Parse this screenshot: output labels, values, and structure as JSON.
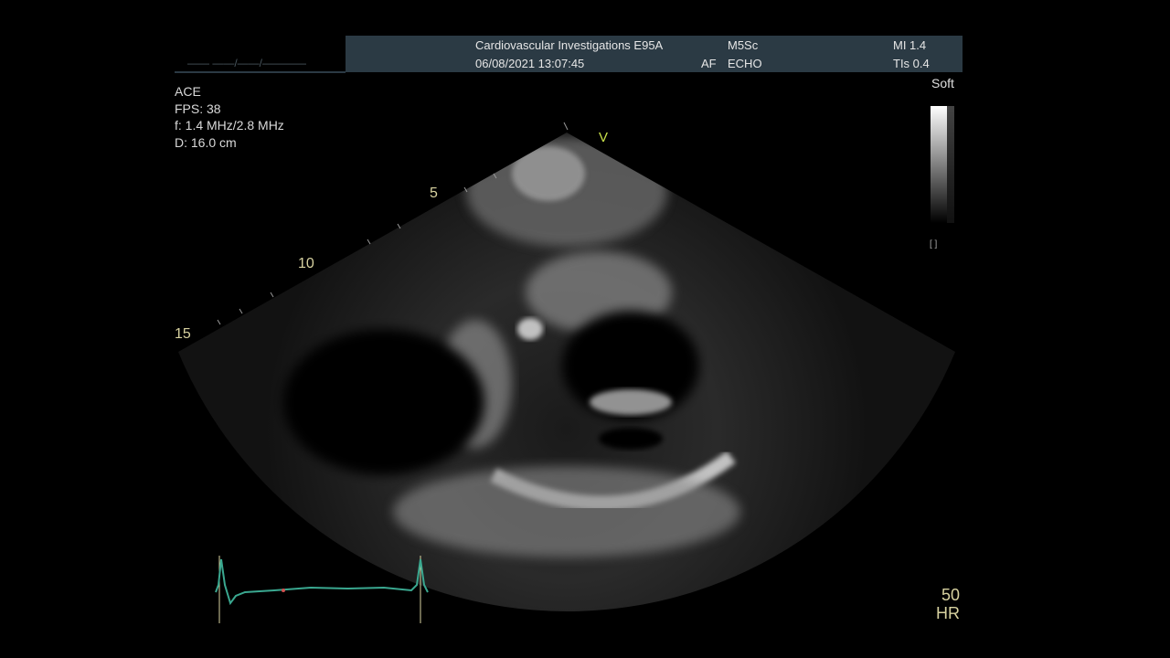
{
  "header": {
    "institution": "Cardiovascular Investigations E95A",
    "datetime": "06/08/2021 13:07:45",
    "probe": "M5Sc",
    "mode": "ECHO",
    "af_label": "AF",
    "mi": "MI 1.4",
    "tis": "TIs 0.4",
    "ghost_text": "—— ——/——/————"
  },
  "acquisition": {
    "preset": "ACE",
    "fps": "FPS: 38",
    "frequency": "f: 1.4 MHz/2.8 MHz",
    "depth": "D: 16.0 cm"
  },
  "grayscale": {
    "label": "Soft"
  },
  "depth_markers": [
    "5",
    "10",
    "15"
  ],
  "orientation_marker": "V",
  "heart_rate": {
    "value": "50",
    "unit": "HR"
  },
  "colors": {
    "header_bg": "#2b3a44",
    "ecg_trace": "#3aa890",
    "ecg_marker": "#d8d2a0",
    "depth_text": "#d8d2a0",
    "orientation": "#c8e04a"
  }
}
